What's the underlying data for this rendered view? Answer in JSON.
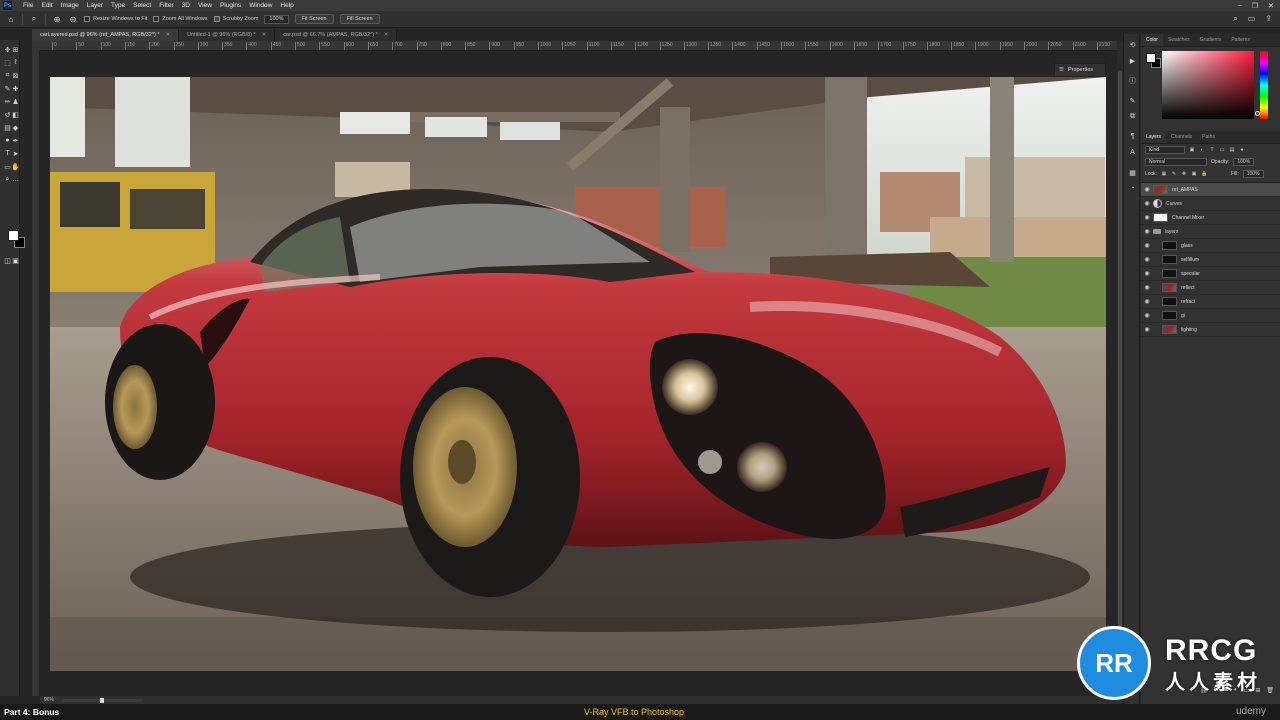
{
  "app": {
    "logo": "Ps"
  },
  "menu": [
    "File",
    "Edit",
    "Image",
    "Layer",
    "Type",
    "Select",
    "Filter",
    "3D",
    "View",
    "Plugins",
    "Window",
    "Help"
  ],
  "options": {
    "resize_windows": "Resize Windows to Fit",
    "zoom_all_windows": "Zoom All Windows",
    "scrubby_zoom": "Scrubby Zoom",
    "zoom_value": "100%",
    "fit_screen": "Fit Screen",
    "fill_screen": "Fill Screen"
  },
  "tabs": [
    {
      "label": "carLayered.psd @ 96% (ref_AMPAS, RGB/32*) *",
      "active": true
    },
    {
      "label": "Untitled-1 @ 96% (RGB/8) *",
      "active": false
    },
    {
      "label": "car.psd @ 66.7% (AMPAS, RGB/32*) *",
      "active": false
    }
  ],
  "ruler_ticks": [
    "0",
    "50",
    "100",
    "150",
    "200",
    "250",
    "300",
    "350",
    "400",
    "450",
    "500",
    "550",
    "600",
    "650",
    "700",
    "750",
    "800",
    "850",
    "900",
    "950",
    "1000",
    "1050",
    "1100",
    "1150",
    "1200",
    "1250",
    "1300",
    "1350",
    "1400",
    "1450",
    "1500",
    "1550",
    "1600",
    "1650",
    "1700",
    "1750",
    "1800",
    "1850",
    "1900",
    "1950",
    "2000",
    "2050",
    "2100",
    "2150"
  ],
  "properties": {
    "label": "Properties"
  },
  "status": {
    "zoom": "96%"
  },
  "panels": {
    "color_tabs": [
      "Color",
      "Swatches",
      "Gradients",
      "Patterns"
    ],
    "layers_tabs": [
      "Layers",
      "Channels",
      "Paths"
    ],
    "kind": "Kind",
    "blend_mode": "Normal",
    "opacity_label": "Opacity:",
    "opacity_value": "100%",
    "lock_label": "Lock:",
    "fill_label": "Fill:",
    "fill_value": "100%"
  },
  "layers": [
    {
      "name": "ref_AMPAS",
      "thumb": "photo",
      "selected": true,
      "indent": false
    },
    {
      "name": "Curves",
      "thumb": "adjust",
      "selected": false,
      "indent": false
    },
    {
      "name": "Channel Mixer",
      "thumb": "white",
      "selected": false,
      "indent": false
    },
    {
      "name": "layers",
      "thumb": "folder",
      "selected": false,
      "indent": false
    },
    {
      "name": "glass",
      "thumb": "dark",
      "selected": false,
      "indent": true
    },
    {
      "name": "selfillum",
      "thumb": "dark",
      "selected": false,
      "indent": true
    },
    {
      "name": "specular",
      "thumb": "dark",
      "selected": false,
      "indent": true
    },
    {
      "name": "reflect",
      "thumb": "photo",
      "selected": false,
      "indent": true
    },
    {
      "name": "refract",
      "thumb": "dark",
      "selected": false,
      "indent": true
    },
    {
      "name": "gi",
      "thumb": "dark",
      "selected": false,
      "indent": true
    },
    {
      "name": "lighting",
      "thumb": "photo",
      "selected": false,
      "indent": true
    }
  ],
  "caption": {
    "left": "Part 4: Bonus",
    "center": "V-Ray VFB to Photoshop",
    "right": "udemy"
  },
  "watermark": {
    "text1": "RRCG",
    "text2": "人人素材"
  },
  "colors": {
    "foreground": "#ffffff",
    "background": "#000000",
    "caption_accent": "#f2c200",
    "car_body": "#b3262b"
  }
}
